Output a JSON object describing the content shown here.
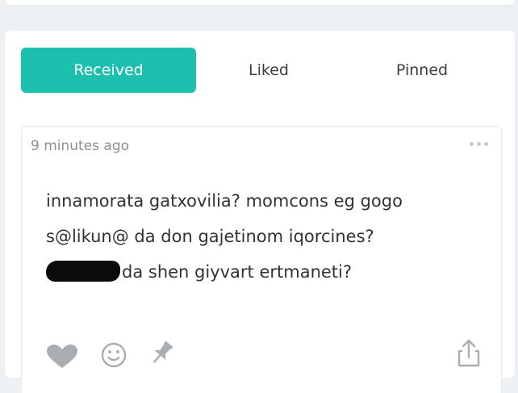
{
  "tabs": [
    {
      "label": "Received",
      "active": true
    },
    {
      "label": "Liked",
      "active": false
    },
    {
      "label": "Pinned",
      "active": false
    }
  ],
  "post": {
    "timestamp": "9 minutes ago",
    "lines": [
      "innamorata gatxovilia? momcons eg gogo",
      "s@likun@ da don gajetinom iqorcines?",
      "da shen giyvart ertmaneti?"
    ]
  },
  "actions": {
    "icons": [
      "heart-icon",
      "smiley-icon",
      "pin-icon",
      "share-icon"
    ]
  },
  "colors": {
    "accent": "#1dbfae",
    "icon": "#a9aeb3",
    "text": "#2f3338",
    "muted": "#8b9096"
  }
}
